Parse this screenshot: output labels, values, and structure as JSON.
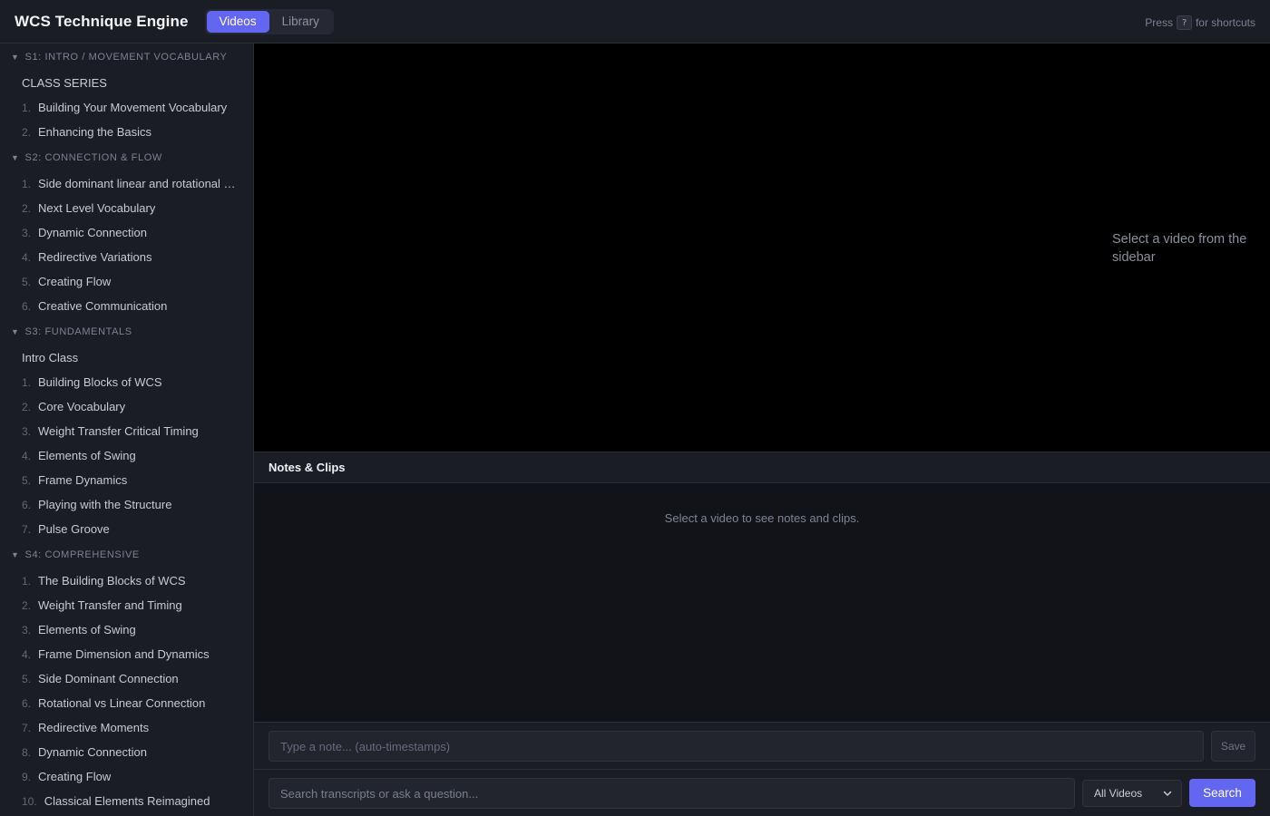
{
  "header": {
    "title": "WCS Technique Engine",
    "tabs": [
      {
        "label": "Videos",
        "active": true
      },
      {
        "label": "Library",
        "active": false
      }
    ],
    "hint_prefix": "Press",
    "hint_key": "?",
    "hint_suffix": "for shortcuts"
  },
  "sidebar": {
    "sections": [
      {
        "title": "S1: INTRO / MOVEMENT VOCABULARY",
        "items": [
          {
            "num": "",
            "label": "CLASS SERIES"
          },
          {
            "num": "1.",
            "label": "Building Your Movement Vocabulary"
          },
          {
            "num": "2.",
            "label": "Enhancing the Basics"
          }
        ]
      },
      {
        "title": "S2: CONNECTION & FLOW",
        "items": [
          {
            "num": "1.",
            "label": "Side dominant linear and rotational c..."
          },
          {
            "num": "2.",
            "label": "Next Level Vocabulary"
          },
          {
            "num": "3.",
            "label": "Dynamic Connection"
          },
          {
            "num": "4.",
            "label": "Redirective Variations"
          },
          {
            "num": "5.",
            "label": "Creating Flow"
          },
          {
            "num": "6.",
            "label": "Creative Communication"
          }
        ]
      },
      {
        "title": "S3: FUNDAMENTALS",
        "items": [
          {
            "num": "",
            "label": "Intro Class"
          },
          {
            "num": "1.",
            "label": "Building Blocks of WCS"
          },
          {
            "num": "2.",
            "label": "Core Vocabulary"
          },
          {
            "num": "3.",
            "label": "Weight Transfer Critical Timing"
          },
          {
            "num": "4.",
            "label": "Elements of Swing"
          },
          {
            "num": "5.",
            "label": "Frame Dynamics"
          },
          {
            "num": "6.",
            "label": "Playing with the Structure"
          },
          {
            "num": "7.",
            "label": "Pulse Groove"
          }
        ]
      },
      {
        "title": "S4: COMPREHENSIVE",
        "items": [
          {
            "num": "1.",
            "label": "The Building Blocks of WCS"
          },
          {
            "num": "2.",
            "label": "Weight Transfer and Timing"
          },
          {
            "num": "3.",
            "label": "Elements of Swing"
          },
          {
            "num": "4.",
            "label": "Frame Dimension and Dynamics"
          },
          {
            "num": "5.",
            "label": "Side Dominant Connection"
          },
          {
            "num": "6.",
            "label": "Rotational vs Linear Connection"
          },
          {
            "num": "7.",
            "label": "Redirective Moments"
          },
          {
            "num": "8.",
            "label": "Dynamic Connection"
          },
          {
            "num": "9.",
            "label": "Creating Flow"
          },
          {
            "num": "10.",
            "label": "Classical Elements Reimagined"
          }
        ]
      }
    ]
  },
  "player": {
    "empty_message": "Select a video from the sidebar"
  },
  "notes": {
    "title": "Notes & Clips",
    "empty_message": "Select a video to see notes and clips.",
    "input_placeholder": "Type a note... (auto-timestamps)",
    "save_label": "Save"
  },
  "search": {
    "placeholder": "Search transcripts or ask a question...",
    "scope_value": "All Videos",
    "button_label": "Search"
  },
  "colors": {
    "accent": "#6366f1",
    "panel": "#1b1d25",
    "background": "#111318"
  }
}
